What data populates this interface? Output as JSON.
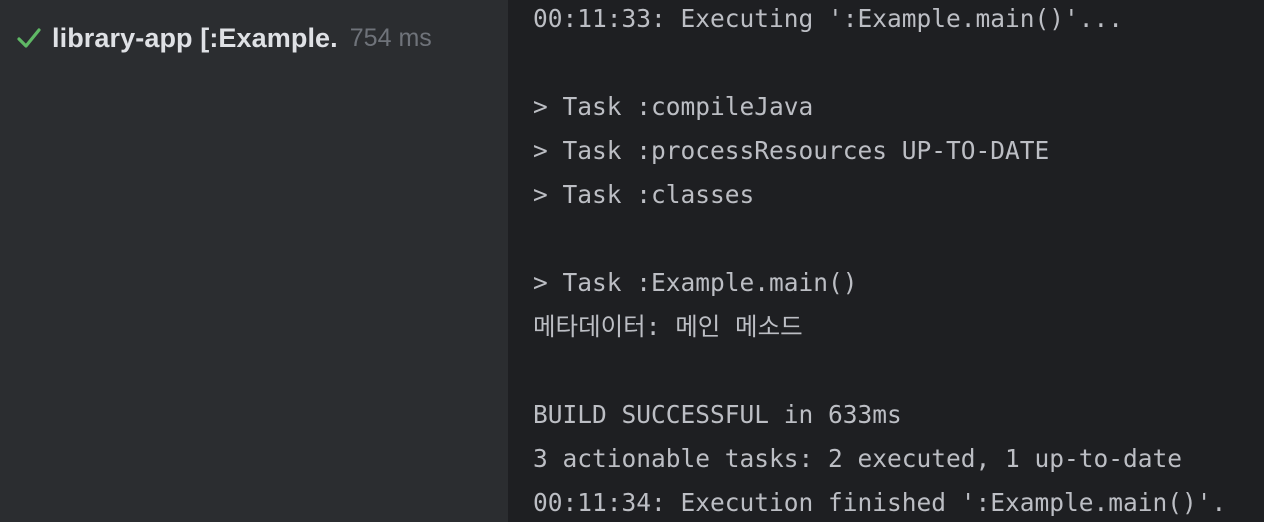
{
  "run_tree": {
    "status_icon": "check-icon",
    "status_color": "#5fb865",
    "title": "library-app [:Example.",
    "duration": "754 ms"
  },
  "console": {
    "lines": [
      "00:11:33: Executing ':Example.main()'...",
      "",
      "> Task :compileJava",
      "> Task :processResources UP-TO-DATE",
      "> Task :classes",
      "",
      "> Task :Example.main()",
      "메타데이터: 메인 메소드",
      "",
      "BUILD SUCCESSFUL in 633ms",
      "3 actionable tasks: 2 executed, 1 up-to-date",
      "00:11:34: Execution finished ':Example.main()'."
    ]
  }
}
